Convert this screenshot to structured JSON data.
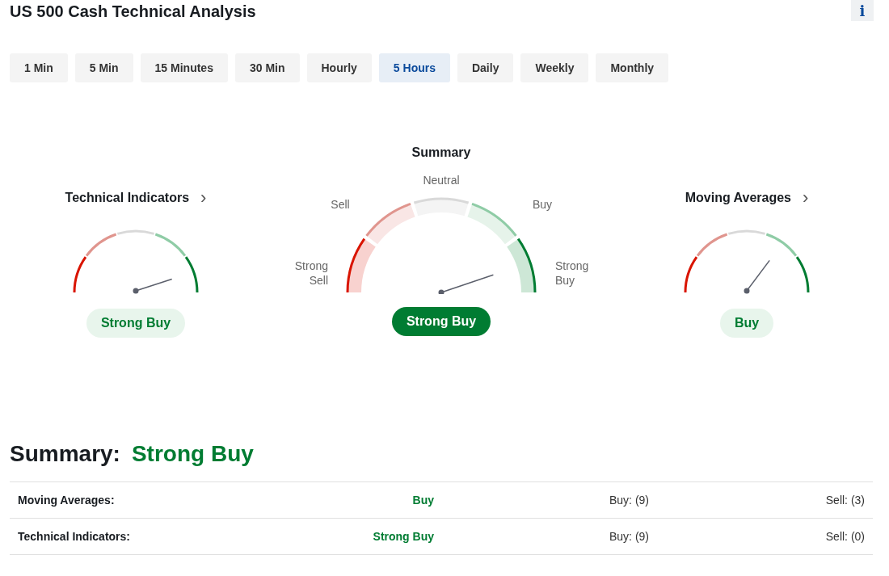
{
  "title": "US 500 Cash Technical Analysis",
  "info_label": "i",
  "tabs": [
    {
      "label": "1 Min",
      "selected": false
    },
    {
      "label": "5 Min",
      "selected": false
    },
    {
      "label": "15 Minutes",
      "selected": false
    },
    {
      "label": "30 Min",
      "selected": false
    },
    {
      "label": "Hourly",
      "selected": false
    },
    {
      "label": "5 Hours",
      "selected": true
    },
    {
      "label": "Daily",
      "selected": false
    },
    {
      "label": "Weekly",
      "selected": false
    },
    {
      "label": "Monthly",
      "selected": false
    }
  ],
  "gauges": [
    {
      "kind": "detail",
      "title": "Technical Indicators",
      "chevron": "›",
      "verdict": "Strong Buy"
    },
    {
      "kind": "summary",
      "title": "Summary",
      "verdict": "Strong Buy",
      "scale_labels": [
        "Strong Sell",
        "Sell",
        "Neutral",
        "Buy",
        "Strong Buy"
      ]
    },
    {
      "kind": "detail",
      "title": "Moving Averages",
      "chevron": "›",
      "verdict": "Buy"
    }
  ],
  "summary": {
    "label": "Summary:",
    "verdict": "Strong Buy"
  },
  "rows": [
    {
      "label": "Moving Averages:",
      "verdict": "Buy",
      "buy": "Buy: (9)",
      "sell": "Sell: (3)"
    },
    {
      "label": "Technical Indicators:",
      "verdict": "Strong Buy",
      "buy": "Buy: (9)",
      "sell": "Sell: (0)"
    }
  ]
}
